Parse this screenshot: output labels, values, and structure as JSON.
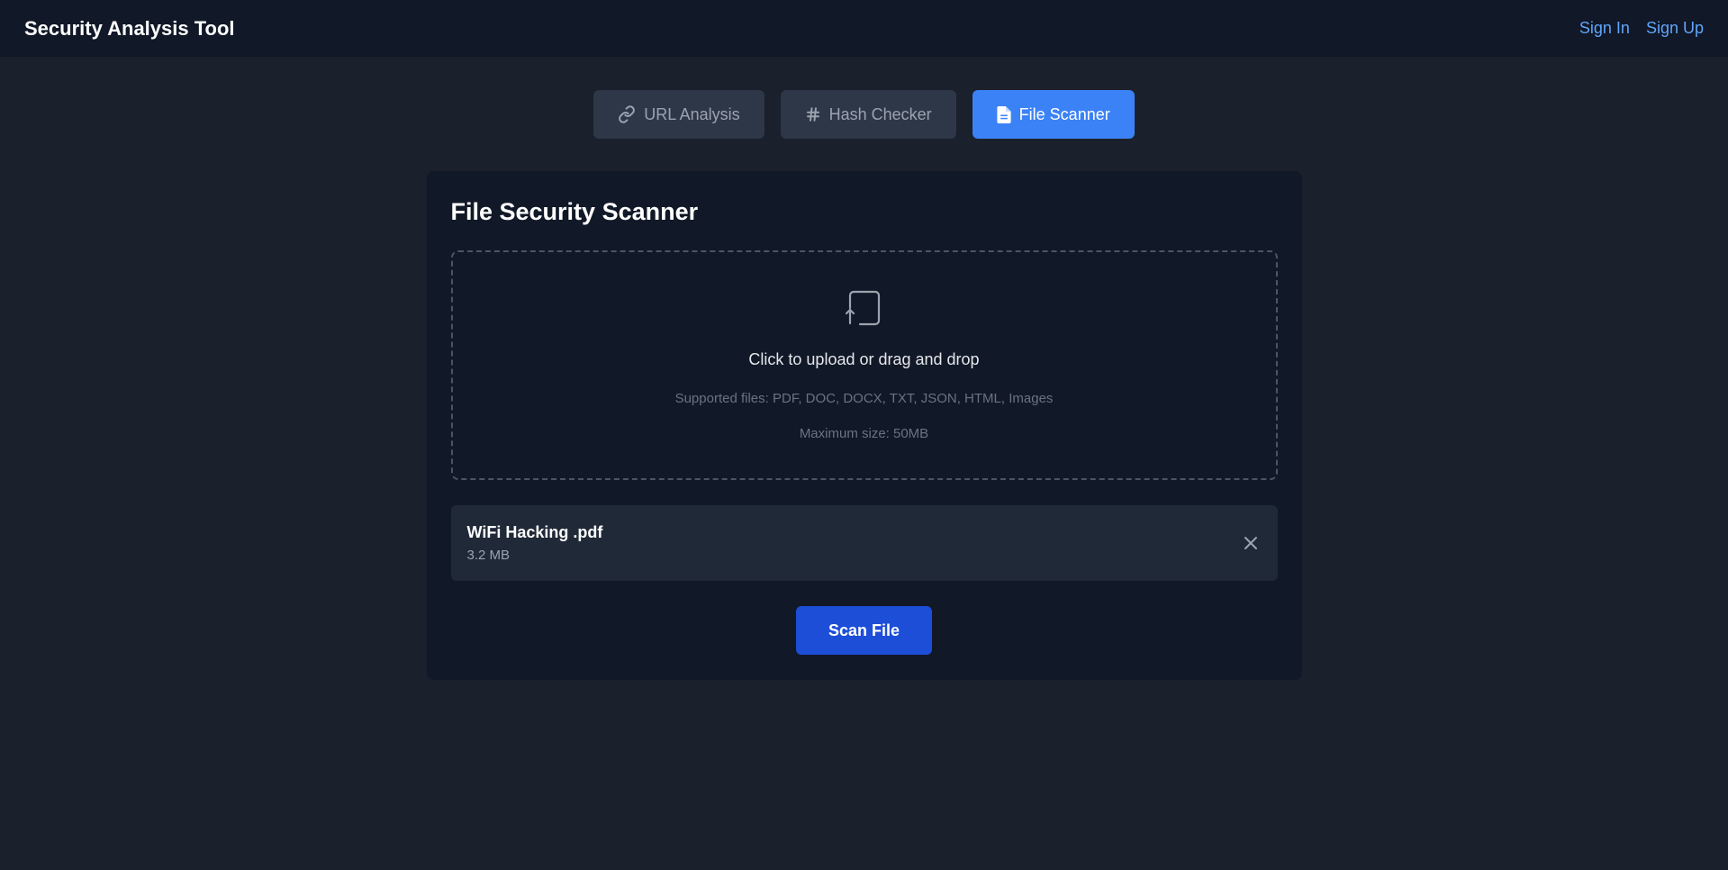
{
  "header": {
    "title": "Security Analysis Tool",
    "sign_in": "Sign In",
    "sign_up": "Sign Up"
  },
  "tabs": [
    {
      "label": "URL Analysis",
      "icon": "link-icon",
      "active": false
    },
    {
      "label": "Hash Checker",
      "icon": "hash-icon",
      "active": false
    },
    {
      "label": "File Scanner",
      "icon": "file-icon",
      "active": true
    }
  ],
  "scanner": {
    "title": "File Security Scanner",
    "dropzone": {
      "icon": "upload-icon",
      "main_text": "Click to upload or drag and drop",
      "supported": "Supported files: PDF, DOC, DOCX, TXT, JSON, HTML, Images",
      "max_size": "Maximum size: 50MB"
    },
    "file": {
      "name": "WiFi Hacking .pdf",
      "size": "3.2 MB"
    },
    "scan_label": "Scan File"
  },
  "colors": {
    "accent": "#3b82f6",
    "scan_button": "#1d4ed8",
    "link": "#60a5fa",
    "background": "#1a202c",
    "card": "#111827"
  }
}
